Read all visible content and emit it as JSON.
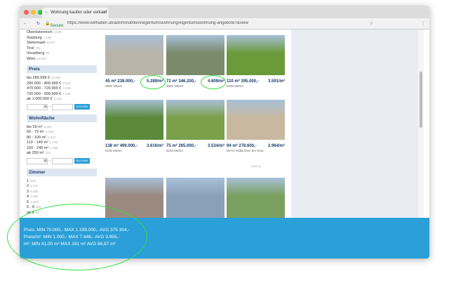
{
  "browser": {
    "tab_title": "Wohnung kaufen oder verkauf",
    "secure_label": "Secure",
    "url": "https://www.willhaben.at/iad/immobilien/eigentumswohnung/eigentumswohnung-angebote?&view"
  },
  "sidebar": {
    "regions": [
      {
        "label": "Oberösterreich",
        "count": "2.409"
      },
      {
        "label": "Salzburg",
        "count": "1.188"
      },
      {
        "label": "Steiermark",
        "count": "3.672"
      },
      {
        "label": "Tirol",
        "count": "751"
      },
      {
        "label": "Vorarlberg",
        "count": "94"
      },
      {
        "label": "Wien",
        "count": "10.987"
      }
    ],
    "price": {
      "title": "Preis",
      "items": [
        {
          "label": "bis 289.999 €",
          "count": "12.594"
        },
        {
          "label": "290.000 - 469.999 €",
          "count": "5.839"
        },
        {
          "label": "470.000 - 729.999 €",
          "count": "3.036"
        },
        {
          "label": "730.000 - 999.999 €",
          "count": "1.048"
        },
        {
          "label": "ab 1.000.000 €",
          "count": "1.155"
        }
      ],
      "button": "SUCHEN"
    },
    "area": {
      "title": "Wohnfläche",
      "items": [
        {
          "label": "bis 59 m²",
          "count": "6.394"
        },
        {
          "label": "60 - 79 m²",
          "count": "5.396"
        },
        {
          "label": "80 - 109 m²",
          "count": "6.542"
        },
        {
          "label": "110 - 149 m²",
          "count": "2.735"
        },
        {
          "label": "150 - 249 m²",
          "count": "1.368"
        },
        {
          "label": "ab 250 m²",
          "count": "421"
        }
      ],
      "button": "SUCHEN"
    },
    "rooms": {
      "title": "Zimmer",
      "items": [
        {
          "label": "1",
          "count": "938"
        },
        {
          "label": "2",
          "count": "6.337"
        },
        {
          "label": "3",
          "count": "8.483"
        },
        {
          "label": "4",
          "count": "4.480"
        },
        {
          "label": "5",
          "count": "1.018"
        },
        {
          "label": "6 - 8",
          "count": "405"
        },
        {
          "label": "ab 9",
          "count": "50"
        }
      ]
    }
  },
  "listings": [
    {
      "size": "45 m²",
      "price": "238.000,-",
      "ppm": "5.289/m²",
      "location": "9500 Villach",
      "img": "#b8b4a8"
    },
    {
      "size": "72 m²",
      "price": "346.200,-",
      "ppm": "4.809/m²",
      "location": "9500 Villach",
      "img": "#7a8a6a"
    },
    {
      "size": "110 m²",
      "price": "395.000,-",
      "ppm": "3.591/m²",
      "location": "6230 Mehrn",
      "img": "#6a9a3a"
    },
    {
      "size": "138 m²",
      "price": "499.000,-",
      "ppm": "3.616/m²",
      "location": "6230 Mehrn",
      "img": "#5a8a3a"
    },
    {
      "size": "75 m²",
      "price": "265.000,-",
      "ppm": "3.534/m²",
      "location": "6230 Mehrn",
      "img": "#7aa04a"
    },
    {
      "size": "94 m²",
      "price": "278.600,-",
      "ppm": "2.964/m²",
      "location": "8573 Feldkirchen bei Graz",
      "img": "#c8b8a0"
    },
    {
      "size": "",
      "price": "",
      "ppm": "",
      "location": "",
      "img": "#9a8a80"
    },
    {
      "size": "",
      "price": "",
      "ppm": "",
      "location": "",
      "img": "#8aa0b8"
    },
    {
      "size": "",
      "price": "",
      "ppm": "",
      "location": "",
      "img": "#7aa060"
    }
  ],
  "ad_label": "Werbung",
  "stats": {
    "line1": "Preis: MIN 70.000,- MAX 1.199.000,- AVG 375.304,-",
    "line2": "Preis/m²: MIN 1.000,- MAX 7.448,- AVG 3.955,-",
    "line3": "m²: MIN 41,00 m² MAX 161 m² AVG 86,87 m²"
  }
}
